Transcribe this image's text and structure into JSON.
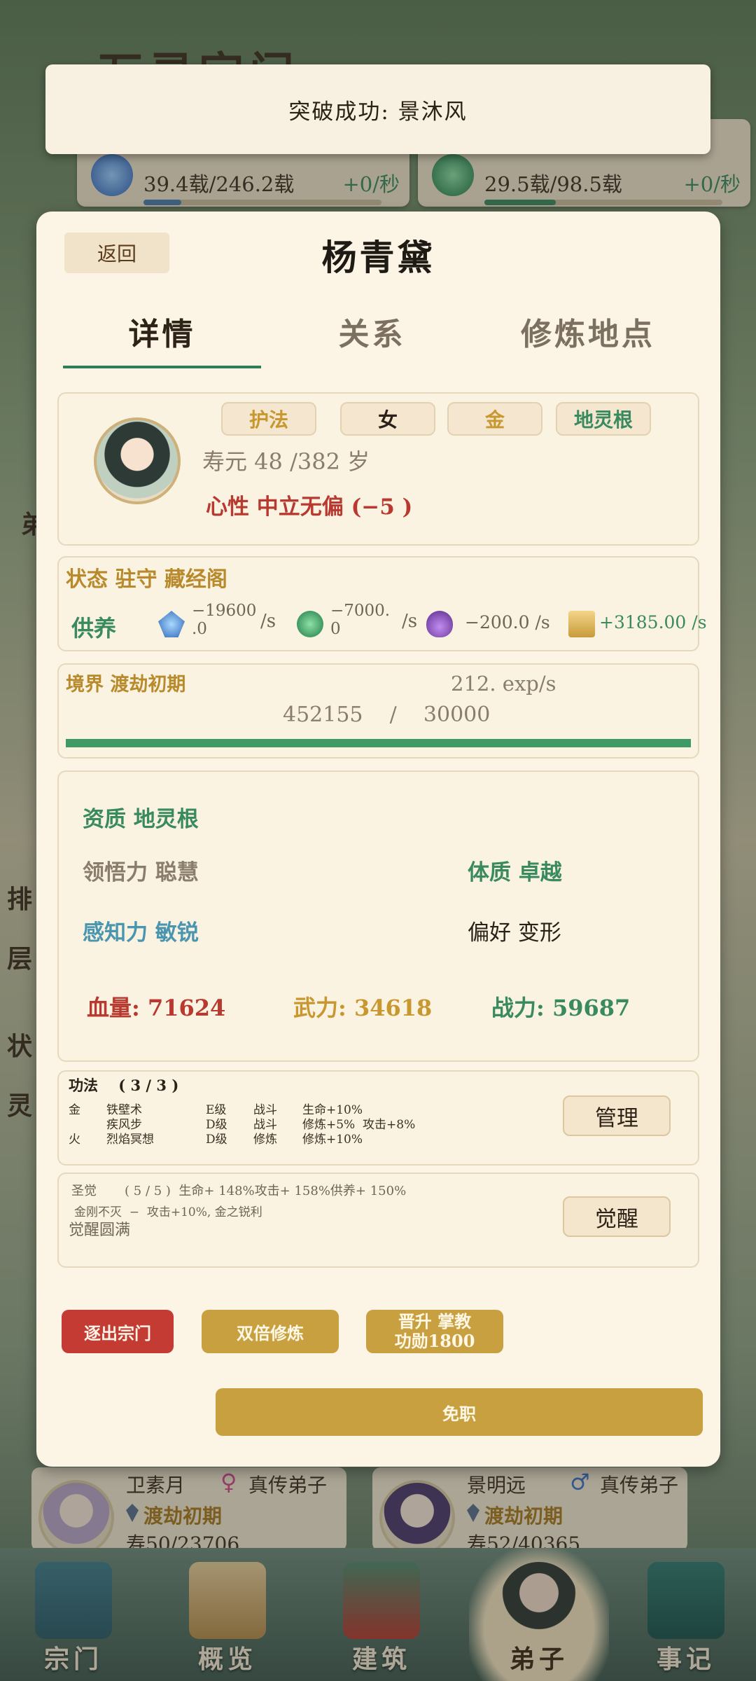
{
  "background": {
    "title": "万灵宗门",
    "resources": [
      {
        "amount": "39.4载/246.2载",
        "rate": "+0/秒",
        "fill": 0.16,
        "color": "#4a7fb0"
      },
      {
        "amount": "29.5载/98.5载",
        "rate": "+0/秒",
        "fill": 0.3,
        "color": "#3a8a5f"
      }
    ],
    "side_glyphs": [
      "弟",
      "排",
      "层",
      "状",
      "灵"
    ],
    "disciples": [
      {
        "name": "卫素月",
        "gender": "♀",
        "rank": "真传弟子",
        "realm": "渡劫初期",
        "lifespan": "寿50/23706"
      },
      {
        "name": "景明远",
        "gender": "♂",
        "rank": "真传弟子",
        "realm": "渡劫初期",
        "lifespan": "寿52/40365"
      }
    ]
  },
  "bottom_nav": [
    {
      "label": "宗门",
      "icon": "gate-icon"
    },
    {
      "label": "概览",
      "icon": "scroll-chart-icon"
    },
    {
      "label": "建筑",
      "icon": "pavilion-icon"
    },
    {
      "label": "弟子",
      "icon": "disciple-icon",
      "active": true
    },
    {
      "label": "事记",
      "icon": "book-icon"
    }
  ],
  "toast": {
    "text": "突破成功:  景沐风"
  },
  "modal": {
    "back_label": "返回",
    "title": "杨青黛",
    "tabs": [
      "详情",
      "关系",
      "修炼地点"
    ],
    "profile": {
      "tags": [
        "护法",
        "女",
        "金",
        "地灵根"
      ],
      "lifespan": "寿元 48  /382 岁",
      "temperament": "心性  中立无偏 (−5    )"
    },
    "status": {
      "label": "状态  驻守  藏经阁",
      "supply_label": "供养",
      "supplies": [
        {
          "icon": "spirit-stone-icon",
          "value": "−19600\n.0",
          "unit": "/s"
        },
        {
          "icon": "jade-icon",
          "value": "−7000.\n0",
          "unit": "/s"
        },
        {
          "icon": "potion-icon",
          "value": "−200.0 /s"
        },
        {
          "icon": "scroll-icon",
          "value": "+3185.00 /s"
        }
      ]
    },
    "realm": {
      "label": "境界  渡劫初期",
      "rate": "212. exp/s",
      "progress": "452155    /    30000",
      "fill": 1.0
    },
    "aptitude": {
      "label": "资质  地灵根",
      "comprehension": "领悟力 聪慧",
      "physique": "体质  卓越",
      "perception": "感知力 敏锐",
      "preference": "偏好   变形",
      "hp": "血量: 71624",
      "force": "武力: 34618",
      "power": "战力: 59687"
    },
    "techniques": {
      "header": "功法    ( 3 / 3 )",
      "manage_label": "管理",
      "rows": [
        {
          "element": "金",
          "name": "铁壁术",
          "grade": "E级",
          "type": "战斗",
          "effect": "生命+10%"
        },
        {
          "element": "",
          "name": "疾风步",
          "grade": "D级",
          "type": "战斗",
          "effect": "修炼+5%  攻击+8%"
        },
        {
          "element": "火",
          "name": "烈焰冥想",
          "grade": "D级",
          "type": "修炼",
          "effect": "修炼+10%"
        }
      ]
    },
    "awakening": {
      "header": "圣觉       ( 5 / 5 )  生命+ 148%攻击+ 158%供养+ 150%",
      "detail": "金刚不灭  −  攻击+10%, 金之锐利",
      "status": "觉醒圆满",
      "button_label": "觉醒"
    },
    "actions": {
      "expel": "逐出宗门",
      "double": "双倍修炼",
      "promote_line1": "晋升 掌教",
      "promote_line2": "功勋1800",
      "dismiss": "免职"
    }
  }
}
